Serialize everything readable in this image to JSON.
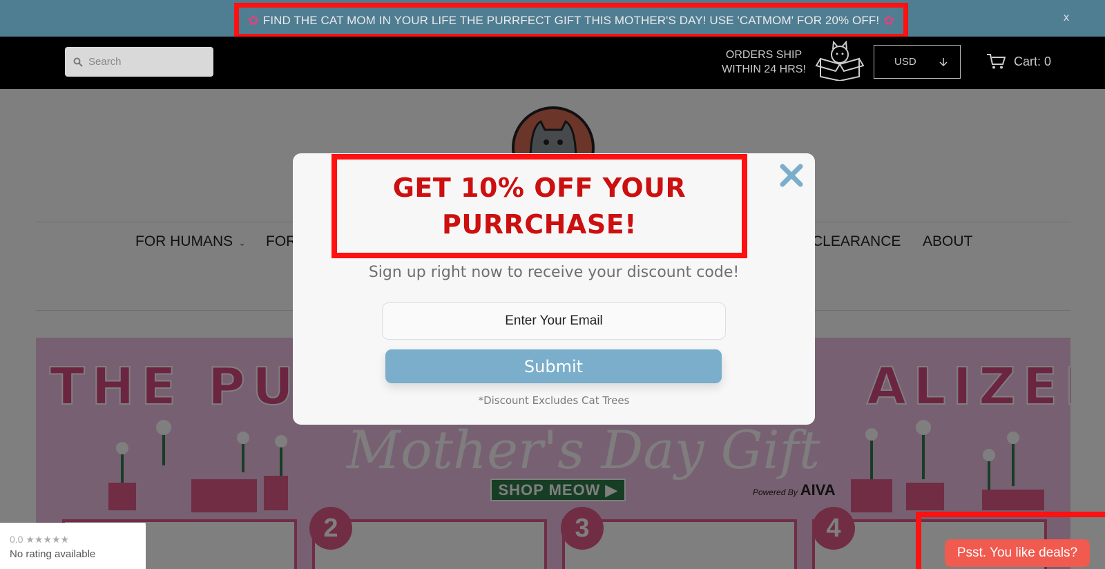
{
  "announcement": {
    "text": "FIND THE CAT MOM IN YOUR LIFE THE PURRFECT GIFT THIS MOTHER'S DAY! USE 'CATMOM' FOR 20% OFF!",
    "left_icon": "flower-icon",
    "right_icon": "flower-icon",
    "close_label": "x",
    "background_color": "#4f7e93"
  },
  "header": {
    "search_placeholder": "Search",
    "shipping_line1": "ORDERS SHIP",
    "shipping_line2": "WITHIN 24 HRS!",
    "currency": "USD",
    "cart_label": "Cart: 0"
  },
  "nav": {
    "items": [
      {
        "label": "FOR HUMANS"
      },
      {
        "label": "FOR"
      },
      {
        "label": "CLEARANCE"
      },
      {
        "label": "ABOUT"
      }
    ]
  },
  "banner": {
    "title_visible_left": "THE PU",
    "title_visible_right": "ALIZED",
    "script_text": "Mother's Day Gift",
    "shop_button": "SHOP MEOW ▶",
    "powered_by": "Powered By",
    "powered_brand": "AIVA",
    "steps": [
      "2",
      "3",
      "4"
    ]
  },
  "modal": {
    "headline_line1": "GET 10% OFF YOUR",
    "headline_line2": "PURRCHASE!",
    "subtext": "Sign up right now to receive your discount code!",
    "email_placeholder": "Enter Your Email",
    "submit_label": "Submit",
    "disclaimer": "*Discount Excludes Cat Trees",
    "accent_color": "#7aaecb",
    "headline_color": "#cc0f0f"
  },
  "rating_widget": {
    "score": "0.0 ★★★★★",
    "status": "No rating available"
  },
  "deals_bubble": {
    "label": "Psst. You like deals?",
    "color": "#f05a4f"
  }
}
